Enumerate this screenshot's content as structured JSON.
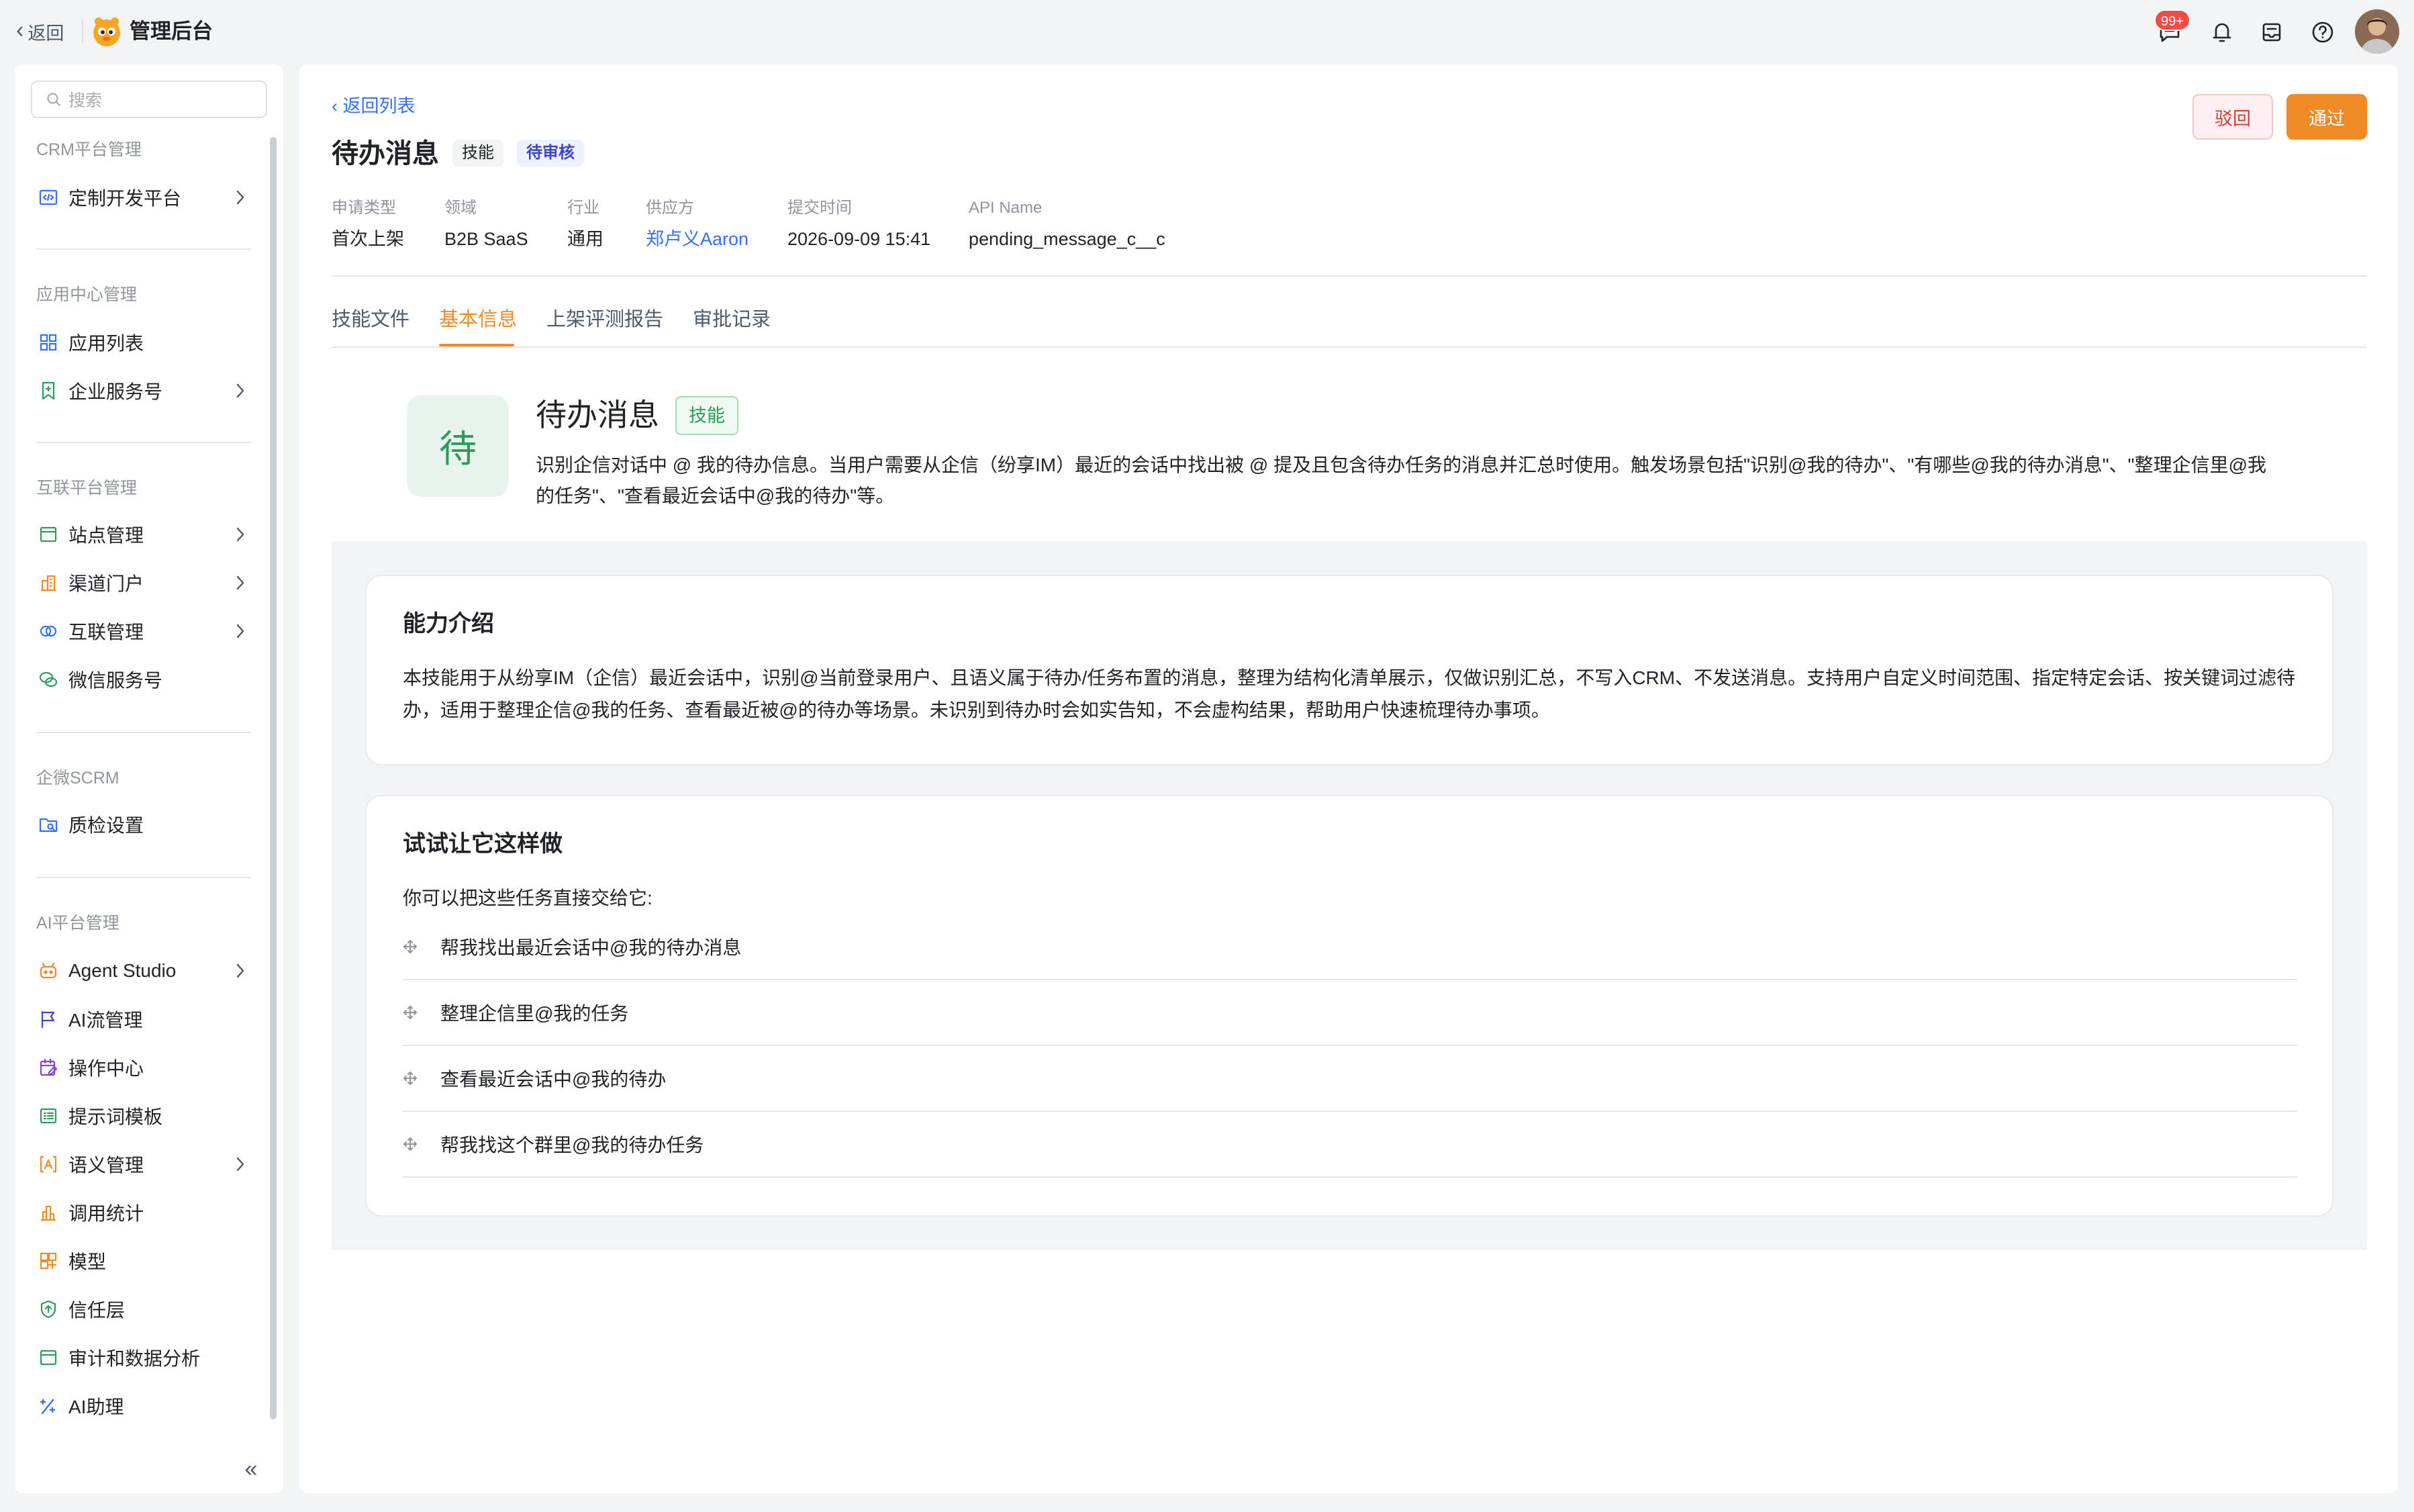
{
  "topbar": {
    "back_label": "返回",
    "app_title": "管理后台",
    "message_badge": "99+"
  },
  "sidebar": {
    "search_placeholder": "搜索",
    "groups": [
      {
        "title": "CRM平台管理",
        "items": [
          {
            "label": "定制开发平台",
            "icon": "code-icon",
            "has_children": true
          }
        ]
      },
      {
        "title": "应用中心管理",
        "items": [
          {
            "label": "应用列表",
            "icon": "grid-icon",
            "has_children": false
          },
          {
            "label": "企业服务号",
            "icon": "bookmark-icon",
            "has_children": true
          }
        ]
      },
      {
        "title": "互联平台管理",
        "items": [
          {
            "label": "站点管理",
            "icon": "window-icon",
            "has_children": true
          },
          {
            "label": "渠道门户",
            "icon": "building-icon",
            "has_children": true
          },
          {
            "label": "互联管理",
            "icon": "link-circles-icon",
            "has_children": true
          },
          {
            "label": "微信服务号",
            "icon": "wechat-icon",
            "has_children": false
          }
        ]
      },
      {
        "title": "企微SCRM",
        "items": [
          {
            "label": "质检设置",
            "icon": "folder-search-icon",
            "has_children": false
          }
        ]
      },
      {
        "title": "AI平台管理",
        "items": [
          {
            "label": "Agent Studio",
            "icon": "robot-icon",
            "has_children": true
          },
          {
            "label": "AI流管理",
            "icon": "flag-icon",
            "has_children": false
          },
          {
            "label": "操作中心",
            "icon": "calendar-edit-icon",
            "has_children": false
          },
          {
            "label": "提示词模板",
            "icon": "template-icon",
            "has_children": false
          },
          {
            "label": "语义管理",
            "icon": "bracket-a-icon",
            "has_children": true
          },
          {
            "label": "调用统计",
            "icon": "bar-chart-icon",
            "has_children": false
          },
          {
            "label": "模型",
            "icon": "cube-grid-icon",
            "has_children": false
          },
          {
            "label": "信任层",
            "icon": "shield-icon",
            "has_children": false
          },
          {
            "label": "审计和数据分析",
            "icon": "window-icon",
            "has_children": false
          },
          {
            "label": "AI助理",
            "icon": "ai-sparkle-icon",
            "has_children": false
          }
        ]
      }
    ]
  },
  "detail": {
    "back_to_list": "‹ 返回列表",
    "title": "待办消息",
    "type_tag": "技能",
    "status_tag": "待审核",
    "reject_label": "驳回",
    "pass_label": "通过",
    "meta": [
      {
        "label": "申请类型",
        "value": "首次上架"
      },
      {
        "label": "领域",
        "value": "B2B SaaS"
      },
      {
        "label": "行业",
        "value": "通用"
      },
      {
        "label": "供应方",
        "value": "郑卢义Aaron",
        "link": true
      },
      {
        "label": "提交时间",
        "value": "2026-09-09 15:41"
      },
      {
        "label": "API Name",
        "value": "pending_message_c__c"
      }
    ],
    "tabs": [
      {
        "label": "技能文件",
        "active": false
      },
      {
        "label": "基本信息",
        "active": true
      },
      {
        "label": "上架评测报告",
        "active": false
      },
      {
        "label": "审批记录",
        "active": false
      }
    ]
  },
  "skill": {
    "icon_char": "待",
    "name": "待办消息",
    "tag": "技能",
    "description": "识别企信对话中 @ 我的待办信息。当用户需要从企信（纷享IM）最近的会话中找出被 @ 提及且包含待办任务的消息并汇总时使用。触发场景包括\"识别@我的待办\"、\"有哪些@我的待办消息\"、\"整理企信里@我的任务\"、\"查看最近会话中@我的待办\"等。"
  },
  "capability": {
    "title": "能力介绍",
    "text": "本技能用于从纷享IM（企信）最近会话中，识别@当前登录用户、且语义属于待办/任务布置的消息，整理为结构化清单展示，仅做识别汇总，不写入CRM、不发送消息。支持用户自定义时间范围、指定特定会话、按关键词过滤待办，适用于整理企信@我的任务、查看最近被@的待办等场景。未识别到待办时会如实告知，不会虚构结果，帮助用户快速梳理待办事项。"
  },
  "try_it": {
    "title": "试试让它这样做",
    "intro": "你可以把这些任务直接交给它:",
    "tasks": [
      "帮我找出最近会话中@我的待办消息",
      "整理企信里@我的任务",
      "查看最近会话中@我的待办",
      "帮我找这个群里@我的待办任务"
    ]
  },
  "colors": {
    "accent": "#f08a24",
    "link": "#3370ff",
    "skill_green": "#2e9b5b",
    "reject_red": "#d83931"
  }
}
